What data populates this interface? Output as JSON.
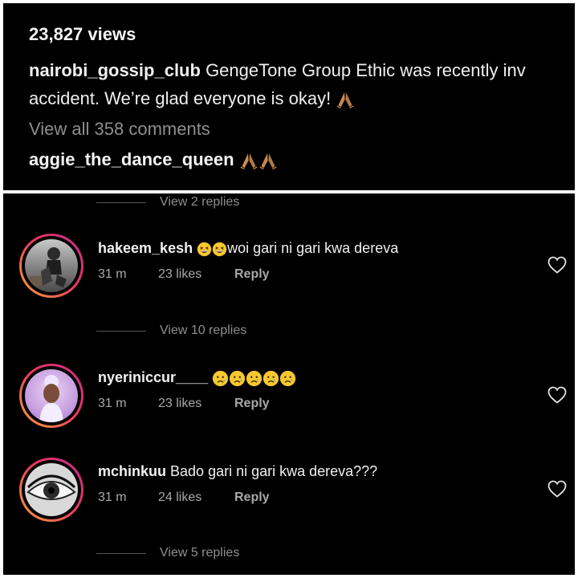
{
  "post": {
    "views": "23,827 views",
    "caption_user": "nairobi_gossip_club",
    "caption_line1": "GengeTone Group Ethic was  recently inv",
    "caption_line2": "accident. We’re glad everyone is okay!",
    "view_all": "View all 358 comments",
    "top_comment_user": "aggie_the_dance_queen"
  },
  "replies": [
    {
      "text": "View 2 replies"
    },
    {
      "text": "View 10 replies"
    },
    {
      "text": "View 5 replies"
    }
  ],
  "comments": [
    {
      "user": "hakeem_kesh",
      "text": "woi gari ni gari kwa dereva",
      "time": "31 m",
      "likes": "23 likes",
      "reply": "Reply"
    },
    {
      "user": "nyeriniccur____",
      "text": "",
      "time": "31 m",
      "likes": "23 likes",
      "reply": "Reply"
    },
    {
      "user": "mchinkuu",
      "text": "Bado gari ni gari kwa dereva???",
      "time": "31 m",
      "likes": "24 likes",
      "reply": "Reply"
    }
  ],
  "icons": {
    "pray": "folded-hands-icon",
    "laugh": "grinning-squinting-face-icon",
    "cry": "crying-face-icon",
    "heart": "heart-outline-icon"
  },
  "colors": {
    "background": "#000000",
    "secondary_text": "#8e8e8e",
    "story_ring_start": "#f9a43a",
    "story_ring_end": "#c62d8f"
  }
}
